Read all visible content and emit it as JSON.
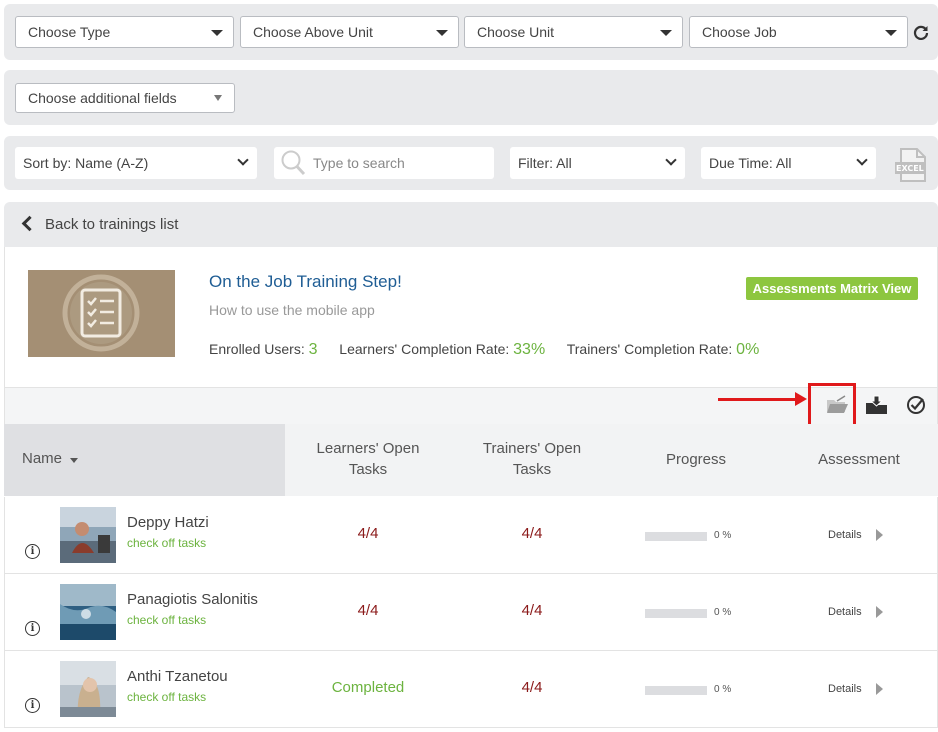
{
  "filters": {
    "type": "Choose Type",
    "above_unit": "Choose Above Unit",
    "unit": "Choose Unit",
    "job": "Choose Job",
    "additional_fields": "Choose additional fields"
  },
  "controls": {
    "sort": "Sort by: Name (A-Z)",
    "search_placeholder": "Type to search",
    "filter": "Filter: All",
    "due_time": "Due Time: All",
    "excel_label": "EXCEL"
  },
  "back_label": "Back to trainings list",
  "training": {
    "title": "On the Job Training Step!",
    "subtitle": "How to use the mobile app",
    "enrolled_label": "Enrolled Users:",
    "enrolled_value": "3",
    "learners_rate_label": "Learners' Completion Rate:",
    "learners_rate_value": "33%",
    "trainers_rate_label": "Trainers' Completion Rate:",
    "trainers_rate_value": "0%",
    "matrix_button": "Assessments Matrix View"
  },
  "table": {
    "headers": {
      "name": "Name",
      "learners_open": "Learners' Open Tasks",
      "trainers_open": "Trainers' Open Tasks",
      "progress": "Progress",
      "assessment": "Assessment"
    },
    "rows": [
      {
        "name": "Deppy Hatzi",
        "action": "check off tasks",
        "learners": "4/4",
        "trainers": "4/4",
        "progress": "0 %",
        "progress_value": 0,
        "details": "Details"
      },
      {
        "name": "Panagiotis Salonitis",
        "action": "check off tasks",
        "learners": "4/4",
        "trainers": "4/4",
        "progress": "0 %",
        "progress_value": 0,
        "details": "Details"
      },
      {
        "name": "Anthi Tzanetou",
        "action": "check off tasks",
        "learners": "Completed",
        "trainers": "4/4",
        "progress": "0 %",
        "progress_value": 0,
        "details": "Details"
      }
    ]
  },
  "colors": {
    "accent_green": "#6cb33f",
    "link_blue": "#1f5d94",
    "open_tasks_red": "#8b1a1a",
    "annotation_red": "#e0191b"
  }
}
